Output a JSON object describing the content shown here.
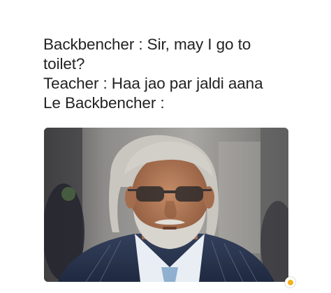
{
  "meme": {
    "caption": {
      "line1": "Backbencher : Sir, may I go to",
      "line2": "toilet?",
      "line3": "Teacher : Haa jao par jaldi aana",
      "line4": "Le Backbencher :"
    },
    "photo_icon": "man-portrait-photo",
    "badge_icon": "emoji-badge-icon",
    "colors": {
      "text": "#222222",
      "suit": "#2a3550",
      "shirt": "#e8eef4",
      "hair": "#c9c5bf",
      "skin": "#b07a5a",
      "badge": "#f2b21b"
    }
  }
}
